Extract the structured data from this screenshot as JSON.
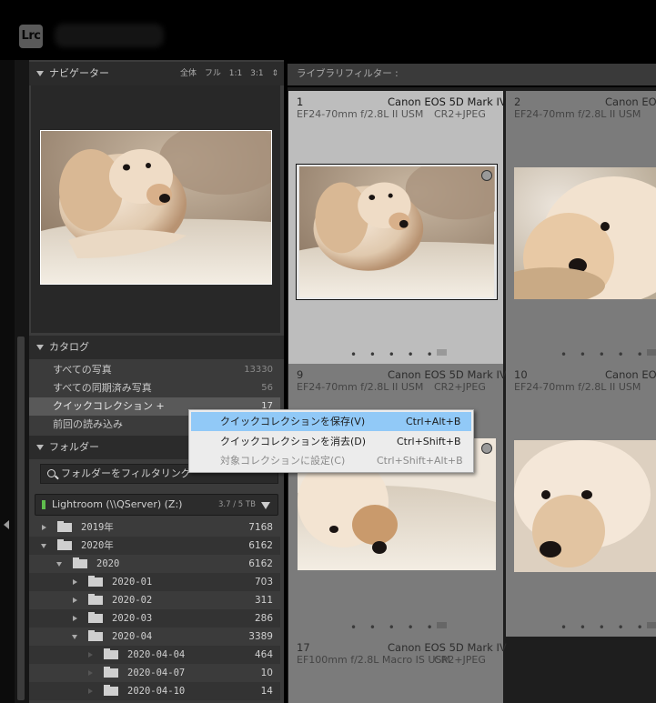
{
  "app": {
    "logo": "Lrc"
  },
  "navigator": {
    "title": "ナビゲーター",
    "zoom_options": [
      "全体",
      "フル",
      "1:1",
      "3:1"
    ],
    "zoom_dropdown_icon": "up-down-arrow-icon"
  },
  "catalog": {
    "title": "カタログ",
    "items": [
      {
        "label": "すべての写真",
        "count": "13330"
      },
      {
        "label": "すべての同期済み写真",
        "count": "56"
      },
      {
        "label": "クイックコレクション +",
        "count": "17"
      },
      {
        "label": "前回の読み込み",
        "count": ""
      }
    ]
  },
  "folders": {
    "title": "フォルダー",
    "filter_placeholder": "フォルダーをフィルタリング",
    "volume": {
      "name": "Lightroom (\\\\QServer) (Z:)",
      "size": "3.7 / 5 TB",
      "status_color": "#5fbd4d"
    },
    "tree": [
      {
        "label": "2019年",
        "count": "7168"
      },
      {
        "label": "2020年",
        "count": "6162"
      },
      {
        "label": "2020",
        "count": "6162"
      },
      {
        "label": "2020-01",
        "count": "703"
      },
      {
        "label": "2020-02",
        "count": "311"
      },
      {
        "label": "2020-03",
        "count": "286"
      },
      {
        "label": "2020-04",
        "count": "3389"
      },
      {
        "label": "2020-04-04",
        "count": "464"
      },
      {
        "label": "2020-04-07",
        "count": "10"
      },
      {
        "label": "2020-04-10",
        "count": "14"
      }
    ]
  },
  "grid": {
    "filter_bar": "ライブラリフィルター :",
    "cells": [
      {
        "num": "1",
        "camera": "Canon EOS 5D Mark IV",
        "lens": "EF24-70mm f/2.8L II USM",
        "format": "CR2+JPEG"
      },
      {
        "num": "2",
        "camera": "Canon EOS",
        "lens": "EF24-70mm f/2.8L II USM",
        "format": ""
      },
      {
        "num": "9",
        "camera": "Canon EOS 5D Mark IV",
        "lens": "EF24-70mm f/2.8L II USM",
        "format": "CR2+JPEG"
      },
      {
        "num": "10",
        "camera": "Canon EOS",
        "lens": "EF24-70mm f/2.8L II USM",
        "format": ""
      },
      {
        "num": "17",
        "camera": "Canon EOS 5D Mark IV",
        "lens": "EF100mm f/2.8L Macro IS USM",
        "format": "CR2+JPEG"
      }
    ],
    "dots": "• • • • •"
  },
  "context_menu": {
    "items": [
      {
        "label": "クイックコレクションを保存(V)",
        "shortcut": "Ctrl+Alt+B",
        "state": "highlighted"
      },
      {
        "label": "クイックコレクションを消去(D)",
        "shortcut": "Ctrl+Shift+B",
        "state": "enabled"
      },
      {
        "label": "対象コレクションに設定(C)",
        "shortcut": "Ctrl+Shift+Alt+B",
        "state": "disabled"
      }
    ]
  },
  "colors": {
    "highlight": "#91c9f7",
    "selected_cell": "#bdbdbd",
    "panel": "#3b3b3b"
  }
}
